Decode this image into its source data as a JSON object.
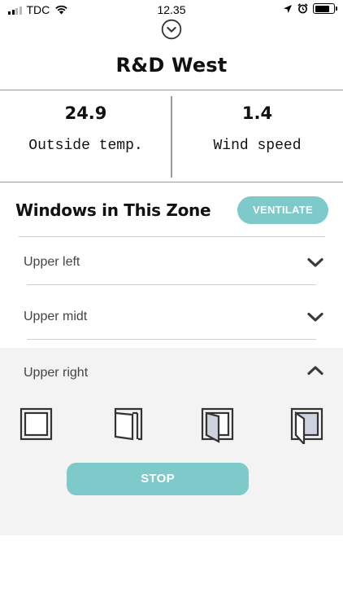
{
  "status_bar": {
    "carrier": "TDC",
    "time": "12.35"
  },
  "header": {
    "title": "R&D West"
  },
  "stats": {
    "outside_temp": {
      "value": "24.9",
      "label": "Outside temp."
    },
    "wind_speed": {
      "value": "1.4",
      "label": "Wind speed"
    }
  },
  "section": {
    "title": "Windows in This Zone",
    "ventilate_label": "VENTILATE"
  },
  "windows": [
    {
      "label": "Upper left",
      "expanded": false
    },
    {
      "label": "Upper midt",
      "expanded": false
    },
    {
      "label": "Upper right",
      "expanded": true
    }
  ],
  "window_positions": [
    "closed-icon",
    "slightly-open-icon",
    "half-open-icon",
    "fully-open-icon"
  ],
  "controls": {
    "stop_label": "STOP"
  },
  "colors": {
    "accent": "#7ec9ca",
    "panel_background": "#f3f3f3",
    "divider": "#9a9a9a"
  }
}
